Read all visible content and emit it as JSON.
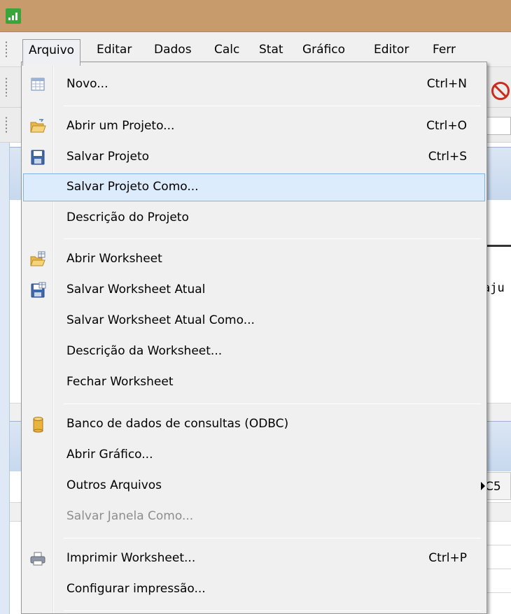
{
  "menubar": {
    "items": [
      {
        "label": "Arquivo"
      },
      {
        "label": "Editar"
      },
      {
        "label": "Dados"
      },
      {
        "label": "Calc"
      },
      {
        "label": "Stat"
      },
      {
        "label": "Gráfico"
      },
      {
        "label": "Editor"
      },
      {
        "label": "Ferr"
      }
    ]
  },
  "background": {
    "session_text": "aju",
    "column_header": "C5"
  },
  "file_menu": {
    "items": [
      {
        "label": "Novo...",
        "shortcut": "Ctrl+N",
        "icon": "new-worksheet-icon"
      },
      {
        "label": "Abrir um Projeto...",
        "shortcut": "Ctrl+O",
        "icon": "open-folder-icon"
      },
      {
        "label": "Salvar Projeto",
        "shortcut": "Ctrl+S",
        "icon": "save-icon"
      },
      {
        "label": "Salvar Projeto Como...",
        "shortcut": "",
        "state": "highlighted"
      },
      {
        "label": "Descrição do Projeto",
        "shortcut": ""
      },
      {
        "label": "Abrir Worksheet",
        "shortcut": "",
        "icon": "open-worksheet-icon"
      },
      {
        "label": "Salvar Worksheet Atual",
        "shortcut": "",
        "icon": "save-worksheet-icon"
      },
      {
        "label": "Salvar Worksheet Atual Como...",
        "shortcut": ""
      },
      {
        "label": "Descrição da Worksheet...",
        "shortcut": ""
      },
      {
        "label": "Fechar Worksheet",
        "shortcut": ""
      },
      {
        "label": "Banco de dados de consultas (ODBC)",
        "shortcut": "",
        "icon": "database-icon"
      },
      {
        "label": "Abrir Gráfico...",
        "shortcut": ""
      },
      {
        "label": "Outros Arquivos",
        "shortcut": "",
        "submenu": true
      },
      {
        "label": "Salvar Janela Como...",
        "shortcut": "",
        "state": "disabled"
      },
      {
        "label": "Imprimir Worksheet...",
        "shortcut": "Ctrl+P",
        "icon": "printer-icon"
      },
      {
        "label": "Configurar impressão...",
        "shortcut": ""
      }
    ]
  },
  "colors": {
    "titlebar": "#c89b6d",
    "highlight_fill": "#dcecfc",
    "highlight_border": "#7eb4ea",
    "disabled_text": "#8d8d8d"
  }
}
